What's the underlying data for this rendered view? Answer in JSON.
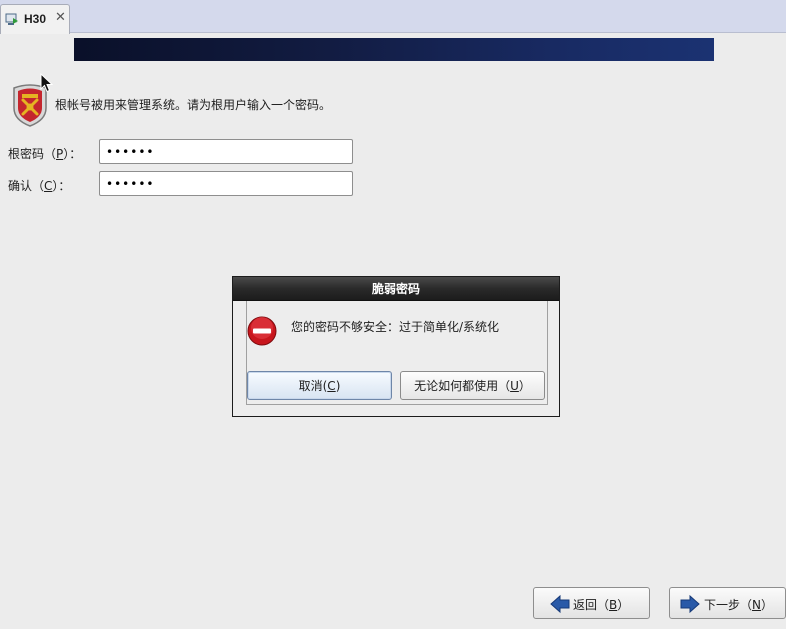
{
  "tab": {
    "title": "H30",
    "close_glyph": "✕",
    "icon": "vm-icon"
  },
  "intro": {
    "text": "根帐号被用来管理系统。请为根用户输入一个密码。",
    "icon": "shield-icon"
  },
  "root_password": {
    "label_pre": "根密码（",
    "mnemonic": "P",
    "label_post": "）：",
    "value": "••••••"
  },
  "confirm_password": {
    "label_pre": "确认（",
    "mnemonic": "C",
    "label_post": "）：",
    "value": "••••••"
  },
  "dialog": {
    "title": "脆弱密码",
    "message": "您的密码不够安全：过于简单化/系统化",
    "icon": "error-icon",
    "cancel_button": {
      "label_pre": "取消(",
      "mnemonic": "C",
      "label_post": ")"
    },
    "use_anyway_button": {
      "label_pre": "无论如何都使用（",
      "mnemonic": "U",
      "label_post": "）"
    }
  },
  "back_button": {
    "label_pre": "返回（",
    "mnemonic": "B",
    "label_post": "）",
    "icon": "arrow-left-icon"
  },
  "next_button": {
    "label_pre": "下一步（",
    "mnemonic": "N",
    "label_post": "）",
    "icon": "arrow-right-icon"
  },
  "colors": {
    "banner_dark": "#0a1029",
    "banner_light": "#1b3272",
    "arrow_blue": "#2a5aa8",
    "error_red": "#c8161d"
  }
}
